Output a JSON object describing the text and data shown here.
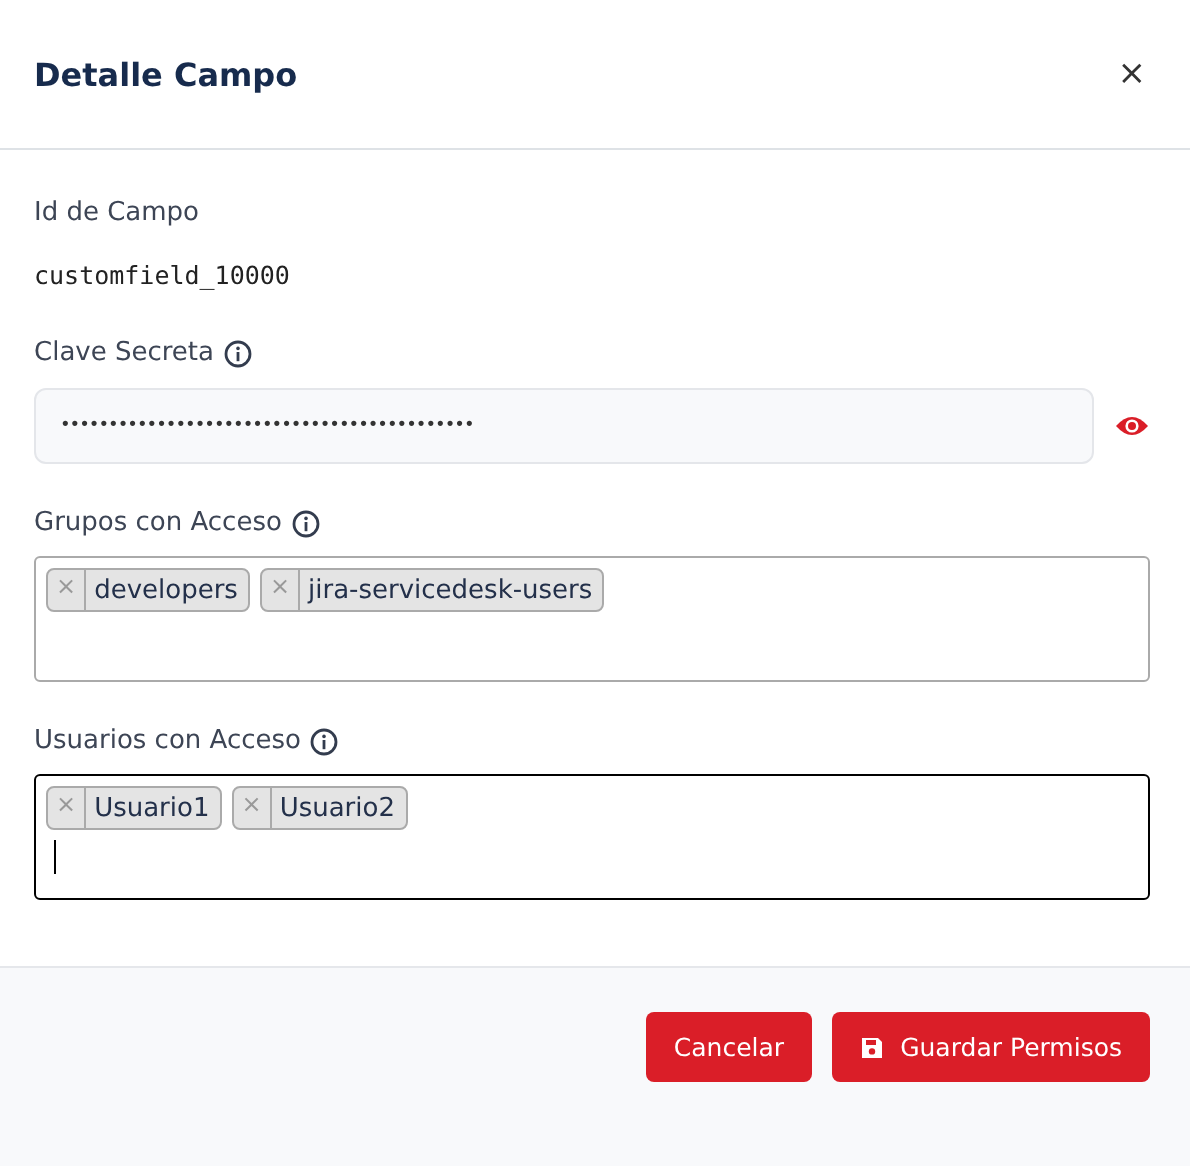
{
  "dialog": {
    "title": "Detalle Campo",
    "close": "×"
  },
  "field_id": {
    "label": "Id de Campo",
    "value": "customfield_10000"
  },
  "secret": {
    "label": "Clave Secreta",
    "value": "•••••••••••••••••••••••••••••••••••••••••••",
    "revealed": false
  },
  "fields": [
    {
      "label": "Grupos con Acceso",
      "focused": false,
      "tags": [
        {
          "remove": "×",
          "label": "developers"
        },
        {
          "remove": "×",
          "label": "jira-servicedesk-users"
        }
      ]
    },
    {
      "label": "Usuarios con Acceso",
      "focused": true,
      "tags": [
        {
          "remove": "×",
          "label": "Usuario1"
        },
        {
          "remove": "×",
          "label": "Usuario2"
        }
      ]
    }
  ],
  "buttons": [
    {
      "kind": "plain",
      "label": "Cancelar"
    },
    {
      "kind": "save",
      "label": "Guardar Permisos"
    }
  ]
}
